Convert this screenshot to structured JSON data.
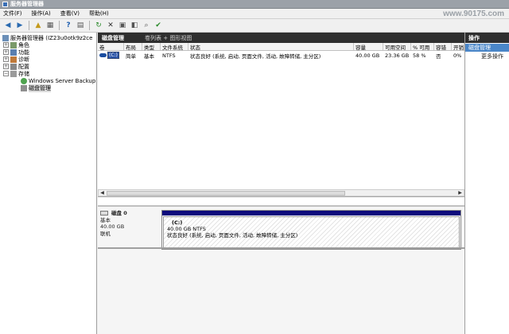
{
  "window": {
    "title": "服务器管理器"
  },
  "watermark": "www.90175.com",
  "menu": [
    {
      "label": "文件(F)"
    },
    {
      "label": "操作(A)"
    },
    {
      "label": "查看(V)"
    },
    {
      "label": "帮助(H)"
    }
  ],
  "tree": {
    "root": "服务器管理器 (IZ23u0otk9z2ce",
    "items": [
      {
        "label": "角色",
        "expander": "+"
      },
      {
        "label": "功能",
        "expander": "+"
      },
      {
        "label": "诊断",
        "expander": "+"
      },
      {
        "label": "配置",
        "expander": "+"
      },
      {
        "label": "存储",
        "expander": "−"
      }
    ],
    "storage_children": [
      {
        "label": "Windows Server Backup"
      },
      {
        "label": "磁盘管理"
      }
    ]
  },
  "center": {
    "title": "磁盘管理",
    "view": "卷列表 + 图形视图",
    "columns": [
      "卷",
      "布局",
      "类型",
      "文件系统",
      "状态",
      "容量",
      "可用空间",
      "% 可用",
      "容错",
      "开销"
    ],
    "rows": [
      {
        "volume": "(C:)",
        "layout": "简单",
        "type": "基本",
        "fs": "NTFS",
        "status": "状态良好 (系统, 启动, 页面文件, 活动, 故障转储, 主分区)",
        "capacity": "40.00 GB",
        "free": "23.36 GB",
        "pct_free": "58 %",
        "fault_tolerant": "否",
        "overhead": "0%"
      }
    ]
  },
  "disk": {
    "name": "磁盘 0",
    "type": "基本",
    "size": "40.00 GB",
    "state": "联机",
    "partition": {
      "label": "(C:)",
      "size_fs": "40.00 GB NTFS",
      "status": "状态良好 (系统, 启动, 页面文件, 活动, 故障转储, 主分区)"
    }
  },
  "actions": {
    "header": "操作",
    "selected": "磁盘管理",
    "more": "更多操作"
  },
  "colors": {
    "accent": "#4a86c8",
    "header_dark": "#2f2f2f",
    "primary_partition": "#0d0a7c"
  }
}
